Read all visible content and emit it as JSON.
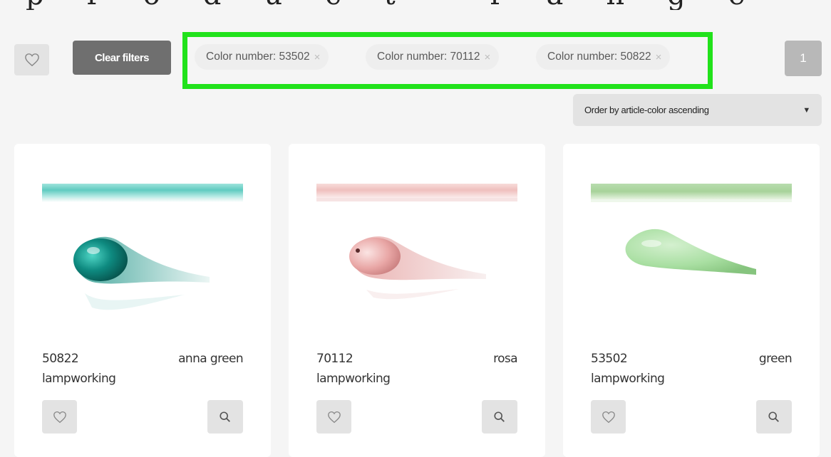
{
  "page": {
    "title": "product range"
  },
  "toolbar": {
    "clear_filters_label": "Clear filters",
    "page_number": "1",
    "filters": [
      {
        "label": "Color number: 53502",
        "remove": "×"
      },
      {
        "label": "Color number: 70112",
        "remove": "×"
      },
      {
        "label": "Color number: 50822",
        "remove": "×"
      }
    ],
    "highlight_color": "#21e21b",
    "sort": {
      "selected": "Order by article-color ascending",
      "arrow": "▼"
    }
  },
  "products": [
    {
      "code": "50822",
      "color_name": "anna green",
      "type": "lampworking",
      "swatch": "#5fcbc0",
      "drop": "#0e8a80"
    },
    {
      "code": "70112",
      "color_name": "rosa",
      "type": "lampworking",
      "swatch": "#f1c7c4",
      "drop": "#e9a7a6"
    },
    {
      "code": "53502",
      "color_name": "green",
      "type": "lampworking",
      "swatch": "#a7d39a",
      "drop": "#a9dfa2"
    }
  ],
  "icons": {
    "favorite": "heart-icon",
    "zoom": "search-icon"
  }
}
